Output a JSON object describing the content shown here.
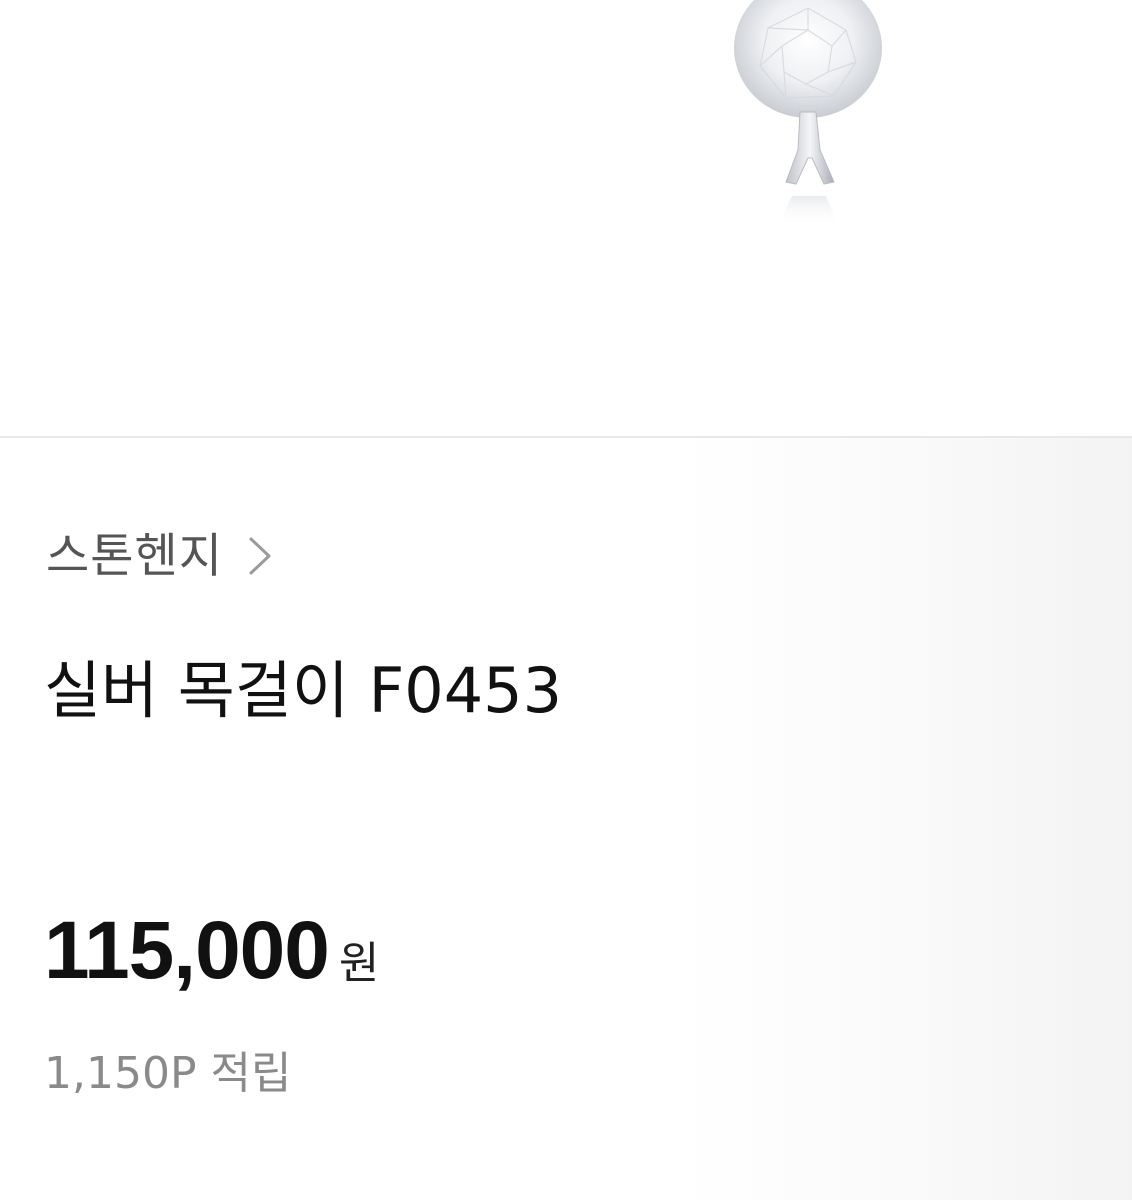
{
  "product": {
    "image_icon": "pendant-necklace-image",
    "brand": "스톤헨지",
    "title": "실버 목걸이 F0453",
    "price": "115,000",
    "price_unit": "원",
    "points": "1,150P 적립"
  },
  "colors": {
    "brand_text": "#555555",
    "title_text": "#111111",
    "price_text": "#111111",
    "points_text": "#8a8a8a",
    "divider": "#e8e8e8"
  }
}
